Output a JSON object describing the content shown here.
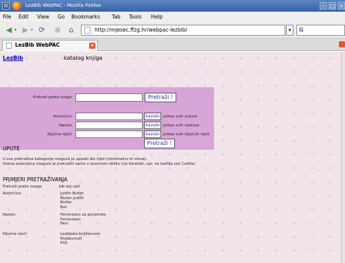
{
  "window": {
    "title": "LezBib WebPAC - Mozilla Firefox"
  },
  "menu": [
    "File",
    "Edit",
    "View",
    "Go",
    "Bookmarks",
    "Tab",
    "Tools",
    "Help"
  ],
  "toolbar": {
    "url": "http://mjesec.ffzg.hr/webpac-lezbib/",
    "search_glyph": "G"
  },
  "tabs": [
    {
      "label": "LezBib WebPAC"
    }
  ],
  "page": {
    "brand": "LezBib",
    "subtitle": "katalog knjiga",
    "search": {
      "main_label": "Pretraži preko svega:",
      "main_button": "Pretraži !",
      "rows": [
        {
          "label": "Autori/ice:",
          "button": "kazalo",
          "hint": "prikaz svih autora"
        },
        {
          "label": "Naslov:",
          "button": "kazalo",
          "hint": "prikaz svih naslova"
        },
        {
          "label": "Ključne riječi:",
          "button": "kazalo",
          "hint": "prikaz svih ključnih riječi"
        }
      ],
      "bottom_button": "Pretraži !"
    },
    "upute": {
      "title": "UPUTE",
      "lines": [
        "U sve pretražive kategorije moguće je upisati dio riječi (minimalno tri slova).",
        "Imena autora/ica moguće je pretražiti samo u izvornom obliku (ne fonetski, npr. ne kalifija već Califia)"
      ]
    },
    "primjeri": {
      "title": "PRIMJERI PRETRAŽIVANJA",
      "rows": [
        {
          "label": "Pretraži preko svega:",
          "values": [
            "bib kej upit"
          ]
        },
        {
          "label": "Autori/ice:",
          "values": [
            "Judith Butler",
            "Butler Judith",
            "Butler",
            "But"
          ]
        },
        {
          "label": "Naslov",
          "values": [
            "Feminizam za početnike",
            "Feminizam",
            "Fem"
          ]
        },
        {
          "label": "Ključne riječi",
          "values": [
            "Lezbijska književnost",
            "Književnost",
            "Knji"
          ]
        }
      ]
    }
  }
}
